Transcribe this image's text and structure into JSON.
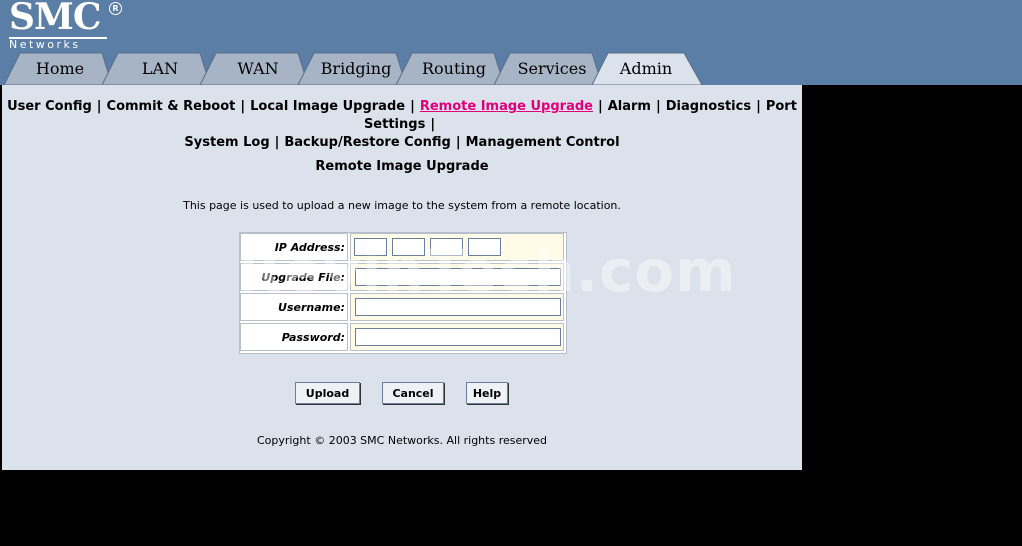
{
  "logo": {
    "brand": "SMC",
    "reg": "R",
    "sub": "Networks"
  },
  "tabs": [
    {
      "label": "Home"
    },
    {
      "label": "LAN"
    },
    {
      "label": "WAN"
    },
    {
      "label": "Bridging"
    },
    {
      "label": "Routing"
    },
    {
      "label": "Services"
    },
    {
      "label": "Admin"
    }
  ],
  "subnav": [
    "User Config",
    "Commit & Reboot",
    "Local Image Upgrade",
    "Remote Image Upgrade",
    "Alarm",
    "Diagnostics",
    "Port Settings",
    "System Log",
    "Backup/Restore Config",
    "Management Control"
  ],
  "page": {
    "title": "Remote Image Upgrade",
    "description": "This page is used to upload a new image to the system from a remote location."
  },
  "form": {
    "ip_label": "IP Address:",
    "file_label": "Upgrade File:",
    "user_label": "Username:",
    "pass_label": "Password:"
  },
  "buttons": {
    "upload": "Upload",
    "cancel": "Cancel",
    "help": "Help"
  },
  "footer": {
    "copyright": "Copyright © 2003 SMC Networks. All rights reserved"
  },
  "watermark": "RevinTech.com"
}
